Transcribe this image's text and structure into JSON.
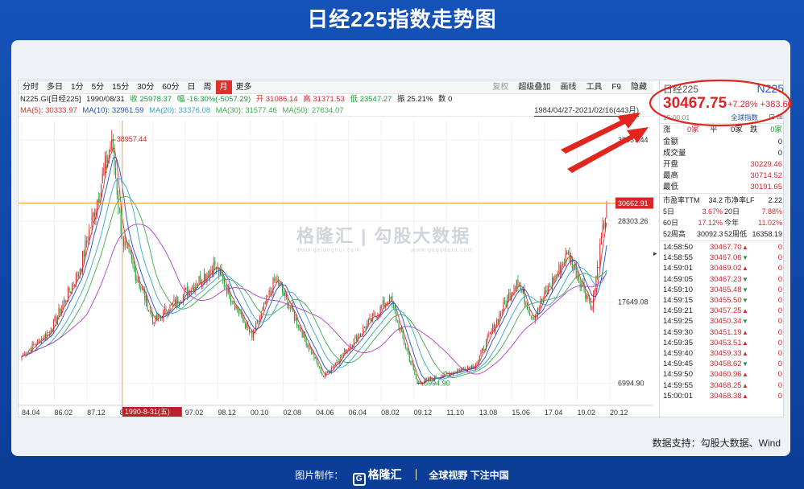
{
  "page": {
    "title": "日经225指数走势图",
    "source": "数据支持：勾股大数据、Wind",
    "footer": {
      "made_by": "图片制作：",
      "brand": "格隆汇",
      "slogan": "全球视野 下注中国"
    },
    "watermark": {
      "brand_main": "格隆汇",
      "brand_main_sub": "www.gelonghui.com",
      "brand_second": "勾股大数据",
      "brand_second_sub": "www.gogudata.com"
    }
  },
  "toolbar": {
    "periods": [
      "分时",
      "多日",
      "1分",
      "5分",
      "15分",
      "30分",
      "60分",
      "日",
      "周",
      "月",
      "更多"
    ],
    "active_period": "月",
    "right_items": [
      {
        "label": "复权",
        "dim": true
      },
      {
        "label": "超级叠加",
        "dim": false
      },
      {
        "label": "画线",
        "dim": false
      },
      {
        "label": "工具",
        "dim": false
      },
      {
        "label": "F9",
        "dim": false
      },
      {
        "label": "隐藏",
        "dim": false
      }
    ]
  },
  "info": {
    "code": "N225.GI[日经225]",
    "date": "1990/08/31",
    "close": "收 25978.37",
    "change": "幅 -16.30%(-5057.29)",
    "open": "开 31086.14",
    "high": "高 31371.53",
    "low": "低 23547.27",
    "amp": "振 25.21%",
    "vol": "数 0"
  },
  "ma": {
    "ma5": "MA(5): 30333.97",
    "ma10": "MA(10): 32961.59",
    "ma20": "MA(20): 33376.08",
    "ma30": "MA(30): 31577.46",
    "ma50": "MA(50): 27634.07",
    "range": "1984/04/27-2021/02/16(443月)"
  },
  "colors": {
    "up": "#d9262a",
    "down": "#1a9a3a",
    "ma5": "#d9332b",
    "ma10": "#1b4fc7",
    "ma20": "#34a6c9",
    "ma30": "#3cab4c",
    "ma50": "#b03cc9",
    "crosshair": "#f0a040"
  },
  "chart_data": {
    "type": "candlestick",
    "title": "日经225指数走势图",
    "y_ticks": [
      "38957.44",
      "28303.26",
      "17649.08",
      "6994.90"
    ],
    "current_label": "30662.91",
    "x_ticks": [
      "84.04",
      "86.02",
      "87.12",
      "89.1",
      "95.04",
      "97.02",
      "98.12",
      "00.10",
      "02.08",
      "04.06",
      "06.04",
      "08.02",
      "09.12",
      "11.10",
      "13.08",
      "15.06",
      "17.04",
      "19.02",
      "20.12"
    ],
    "x_highlight": "1990-8-31(五)",
    "ylim": [
      6994.9,
      38957.44
    ],
    "annotations": {
      "max": "38957.44",
      "min": "6994.90"
    },
    "monthly_close_anchors": [
      {
        "date": "1984.04",
        "value": 10500
      },
      {
        "date": "1986.02",
        "value": 14000
      },
      {
        "date": "1987.12",
        "value": 22000
      },
      {
        "date": "1989.12",
        "value": 38957
      },
      {
        "date": "1990.08",
        "value": 25978
      },
      {
        "date": "1992.08",
        "value": 15000
      },
      {
        "date": "1996.06",
        "value": 22500
      },
      {
        "date": "1998.10",
        "value": 13000
      },
      {
        "date": "2000.04",
        "value": 20800
      },
      {
        "date": "2003.04",
        "value": 7800
      },
      {
        "date": "2007.06",
        "value": 18200
      },
      {
        "date": "2009.03",
        "value": 7000
      },
      {
        "date": "2012.11",
        "value": 9400
      },
      {
        "date": "2015.06",
        "value": 20600
      },
      {
        "date": "2016.06",
        "value": 15600
      },
      {
        "date": "2018.09",
        "value": 24100
      },
      {
        "date": "2020.03",
        "value": 17000
      },
      {
        "date": "2021.02",
        "value": 30468
      }
    ]
  },
  "quote": {
    "name": "日经225",
    "code": "N225",
    "price": "30467.75",
    "change": "+7.28% +383.60",
    "time": "15:00:01",
    "global_link": "全球指数",
    "breadth": {
      "up_label": "涨",
      "up_val": "0家",
      "flat_label": "平",
      "flat_val": "0家",
      "down_label": "跌",
      "down_val": "0家"
    },
    "fields": [
      {
        "k": "金额",
        "v": "0"
      },
      {
        "k": "成交量",
        "v": "0"
      },
      {
        "k": "开盘",
        "v": "30229.46"
      },
      {
        "k": "最高",
        "v": "30714.52"
      },
      {
        "k": "最低",
        "v": "30191.65"
      }
    ],
    "ratios": [
      {
        "k1": "市盈率TTM",
        "v1": "34.2",
        "k2": "市净率LF",
        "v2": "2.22"
      },
      {
        "k1": "5日",
        "v1": "3.67%",
        "k2": "20日",
        "v2": "7.88%"
      },
      {
        "k1": "60日",
        "v1": "17.12%",
        "k2": "今年",
        "v2": "11.02%"
      },
      {
        "k1": "52周高",
        "v1": "30092.3",
        "k2": "52周低",
        "v2": "16358.19"
      }
    ],
    "ticks": [
      {
        "t": "14:58:50",
        "p": "30467.70",
        "d": "up",
        "v": "0"
      },
      {
        "t": "14:58:55",
        "p": "30467.06",
        "d": "down",
        "v": "0"
      },
      {
        "t": "14:59:01",
        "p": "30469.02",
        "d": "up",
        "v": "0"
      },
      {
        "t": "14:59:05",
        "p": "30467.23",
        "d": "down",
        "v": "0"
      },
      {
        "t": "14:59:10",
        "p": "30465.48",
        "d": "down",
        "v": "0"
      },
      {
        "t": "14:59:15",
        "p": "30455.50",
        "d": "down",
        "v": "0"
      },
      {
        "t": "14:59:21",
        "p": "30457.25",
        "d": "up",
        "v": "0"
      },
      {
        "t": "14:59:25",
        "p": "30450.34",
        "d": "down",
        "v": "0"
      },
      {
        "t": "14:59:30",
        "p": "30451.19",
        "d": "up",
        "v": "0"
      },
      {
        "t": "14:59:35",
        "p": "30453.51",
        "d": "up",
        "v": "0"
      },
      {
        "t": "14:59:40",
        "p": "30459.33",
        "d": "up",
        "v": "0"
      },
      {
        "t": "14:59:45",
        "p": "30458.62",
        "d": "down",
        "v": "0"
      },
      {
        "t": "14:59:50",
        "p": "30460.96",
        "d": "up",
        "v": "0"
      },
      {
        "t": "14:59:55",
        "p": "30468.25",
        "d": "up",
        "v": "0"
      },
      {
        "t": "15:00:01",
        "p": "30468.38",
        "d": "up",
        "v": "0"
      }
    ]
  }
}
